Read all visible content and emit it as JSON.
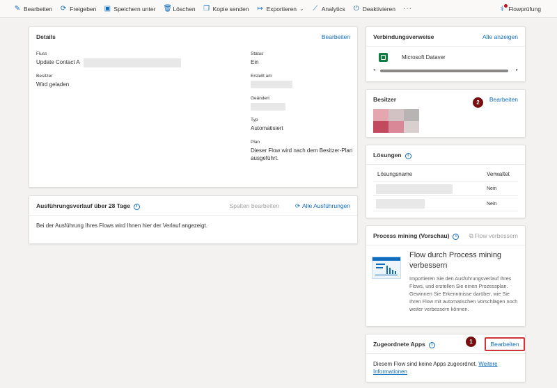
{
  "toolbar": {
    "items": [
      {
        "label": "Bearbeiten",
        "icon": "pencil-icon"
      },
      {
        "label": "Freigeben",
        "icon": "share-icon"
      },
      {
        "label": "Speichern unter",
        "icon": "save-icon"
      },
      {
        "label": "Löschen",
        "icon": "trash-icon"
      },
      {
        "label": "Kopie senden",
        "icon": "copy-icon"
      },
      {
        "label": "Exportieren",
        "icon": "export-icon"
      },
      {
        "label": "Analytics",
        "icon": "chart-icon"
      },
      {
        "label": "Deaktivieren",
        "icon": "power-icon"
      }
    ],
    "more": "···",
    "flowcheck": "Flowprüfung"
  },
  "details": {
    "title": "Details",
    "edit": "Bearbeiten",
    "flow_label": "Fluss",
    "flow_value": "Update Contact A",
    "owner_label": "Besitzer",
    "owner_value": "Wird geladen",
    "status_label": "Status",
    "status_value": "Ein",
    "created_label": "Erstellt am",
    "modified_label": "Geändert",
    "type_label": "Typ",
    "type_value": "Automatisiert",
    "plan_label": "Plan",
    "plan_value": "Dieser Flow wird nach dem Besitzer-Plan ausgeführt."
  },
  "history": {
    "title": "Ausführungsverlauf über 28 Tage",
    "edit_columns": "Spalten bearbeiten",
    "all_runs": "Alle Ausführungen",
    "empty": "Bei der Ausführung Ihres Flows wird Ihnen hier der Verlauf angezeigt."
  },
  "connections": {
    "title": "Verbindungsverweise",
    "show_all": "Alle anzeigen",
    "item": "Microsoft Dataver"
  },
  "owners": {
    "title": "Besitzer",
    "edit": "Bearbeiten",
    "badge": "2"
  },
  "solutions": {
    "title": "Lösungen",
    "col_name": "Lösungsname",
    "col_managed": "Verwaltet",
    "rows": [
      {
        "managed": "Nein"
      },
      {
        "managed": "Nein"
      }
    ]
  },
  "process_mining": {
    "title": "Process mining (Vorschau)",
    "improve": "Flow verbessern",
    "heading": "Flow durch Process mining verbessern",
    "body": "Importieren Sie den Ausführungsverlauf Ihres Flows, und erstellen Sie einen Prozessplan. Gewinnen Sie Erkenntnisse darüber, wie Sie Ihren Flow mit automatischen Vorschlägen noch weiter verbessern können."
  },
  "apps": {
    "title": "Zugeordnete Apps",
    "edit": "Bearbeiten",
    "badge": "1",
    "text": "Diesem Flow sind keine Apps zugeordnet.",
    "more_link": "Weitere Informationen"
  },
  "colors": {
    "accent": "#0f6cbd",
    "badge": "#7a0e0e",
    "highlight": "#d13438",
    "excel_green": "#107c41"
  }
}
